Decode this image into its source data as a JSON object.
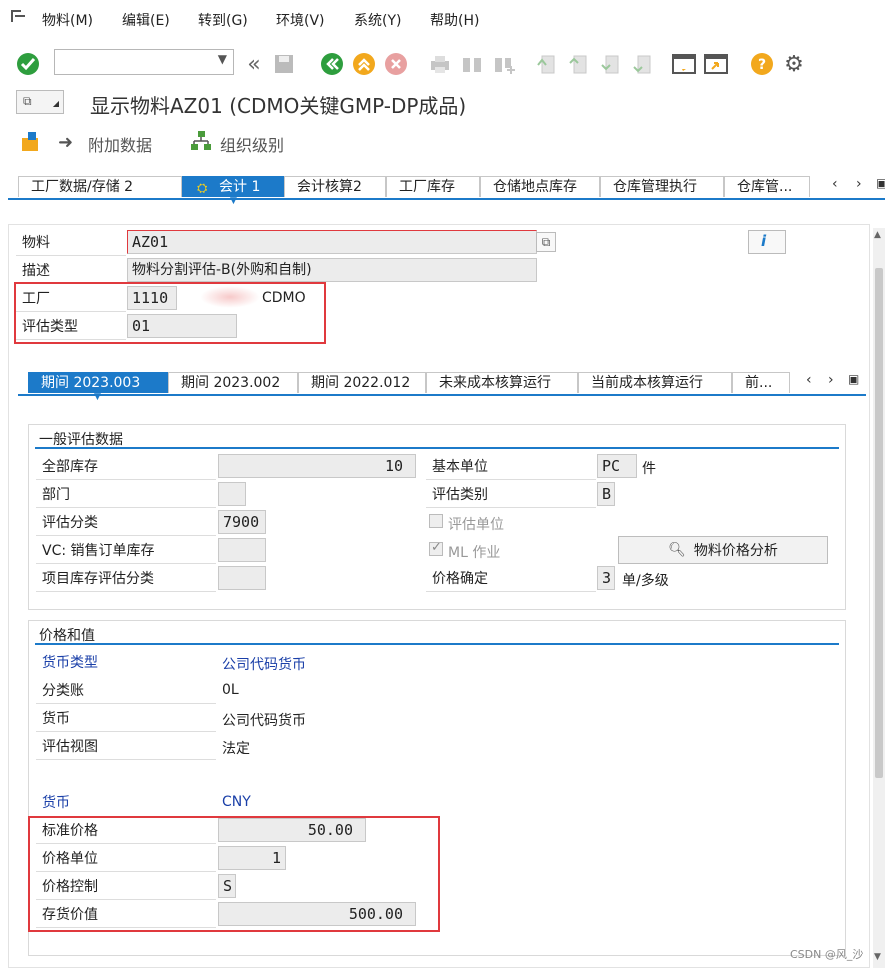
{
  "menu": {
    "items": [
      "物料(M)",
      "编辑(E)",
      "转到(G)",
      "环境(V)",
      "系统(Y)",
      "帮助(H)"
    ]
  },
  "toolbar": {
    "command_field_value": ""
  },
  "title": "显示物料AZ01 (CDMO关键GMP-DP成品)",
  "app_toolbar": {
    "additional_data": "附加数据",
    "org_levels": "组织级别"
  },
  "top_tabs": [
    "工厂数据/存储 2",
    "会计 1",
    "会计核算2",
    "工厂库存",
    "仓储地点库存",
    "仓库管理执行",
    "仓库管..."
  ],
  "header": {
    "material_label": "物料",
    "material_value": "AZ01",
    "desc_label": "描述",
    "desc_value": "物料分割评估-B(外购和自制)",
    "plant_label": "工厂",
    "plant_value": "1110",
    "plant_name": "CDMO",
    "val_type_label": "评估类型",
    "val_type_value": "01"
  },
  "period_tabs": [
    "期间 2023.003",
    "期间 2023.002",
    "期间 2022.012",
    "未来成本核算运行",
    "当前成本核算运行",
    "前..."
  ],
  "general": {
    "title": "一般评估数据",
    "total_stock_label": "全部库存",
    "total_stock_value": "10",
    "division_label": "部门",
    "division_value": "",
    "val_class_label": "评估分类",
    "val_class_value": "7900",
    "vc_label": "VC: 销售订单库存",
    "vc_value": "",
    "proj_label": "项目库存评估分类",
    "proj_value": "",
    "base_unit_label": "基本单位",
    "base_unit_value": "PC",
    "base_unit_text": "件",
    "val_category_label": "评估类别",
    "val_category_value": "B",
    "val_unit_label": "评估单位",
    "ml_label": "ML 作业",
    "price_analysis_button": "物料价格分析",
    "price_det_label": "价格确定",
    "price_det_value": "3",
    "price_det_text": "单/多级"
  },
  "prices": {
    "title": "价格和值",
    "currency_type_label": "货币类型",
    "currency_type_value": "公司代码货币",
    "ledger_label": "分类账",
    "ledger_value": "0L",
    "currency_label": "货币",
    "currency_value": "公司代码货币",
    "view_label": "评估视图",
    "view_value": "法定",
    "cur_label": "货币",
    "cur_value": "CNY",
    "std_price_label": "标准价格",
    "std_price_value": "50.00",
    "price_unit_label": "价格单位",
    "price_unit_value": "1",
    "price_control_label": "价格控制",
    "price_control_value": "S",
    "inventory_value_label": "存货价值",
    "inventory_value_value": "500.00"
  },
  "watermark": "CSDN @风_沙"
}
